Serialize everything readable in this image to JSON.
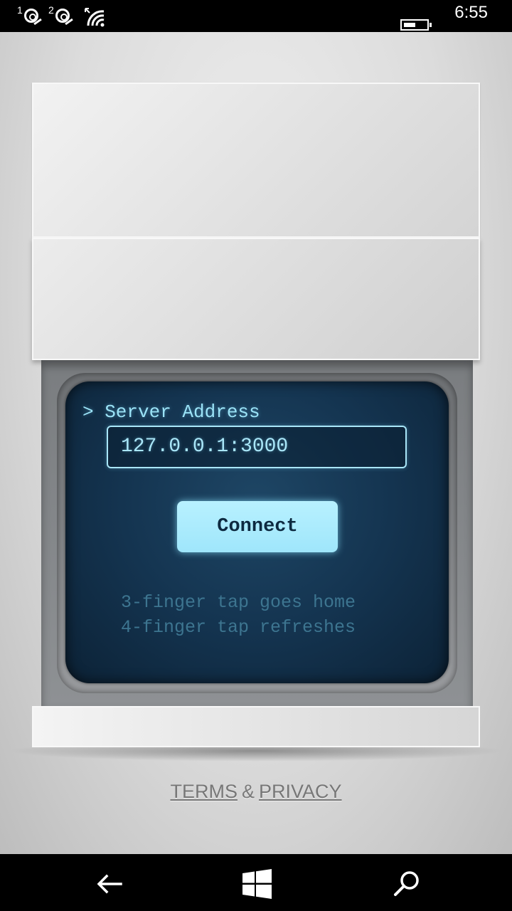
{
  "status_bar": {
    "sim1_label": "1",
    "sim2_label": "2",
    "time": "6:55"
  },
  "terminal": {
    "prompt_label": "> Server Address",
    "server_address_value": "127.0.0.1:3000",
    "connect_label": "Connect",
    "hint_line_1": "3-finger tap goes home",
    "hint_line_2": "4-finger tap refreshes"
  },
  "footer": {
    "terms_label": "TERMS",
    "amp": "&",
    "privacy_label": "PRIVACY"
  },
  "nav_bar": {
    "back_icon": "back-arrow-icon",
    "home_icon": "windows-logo-icon",
    "search_icon": "search-icon"
  },
  "colors": {
    "screen_text": "#9be3f7",
    "button_fill": "#b8f1ff",
    "hint_text": "#3d7590"
  }
}
